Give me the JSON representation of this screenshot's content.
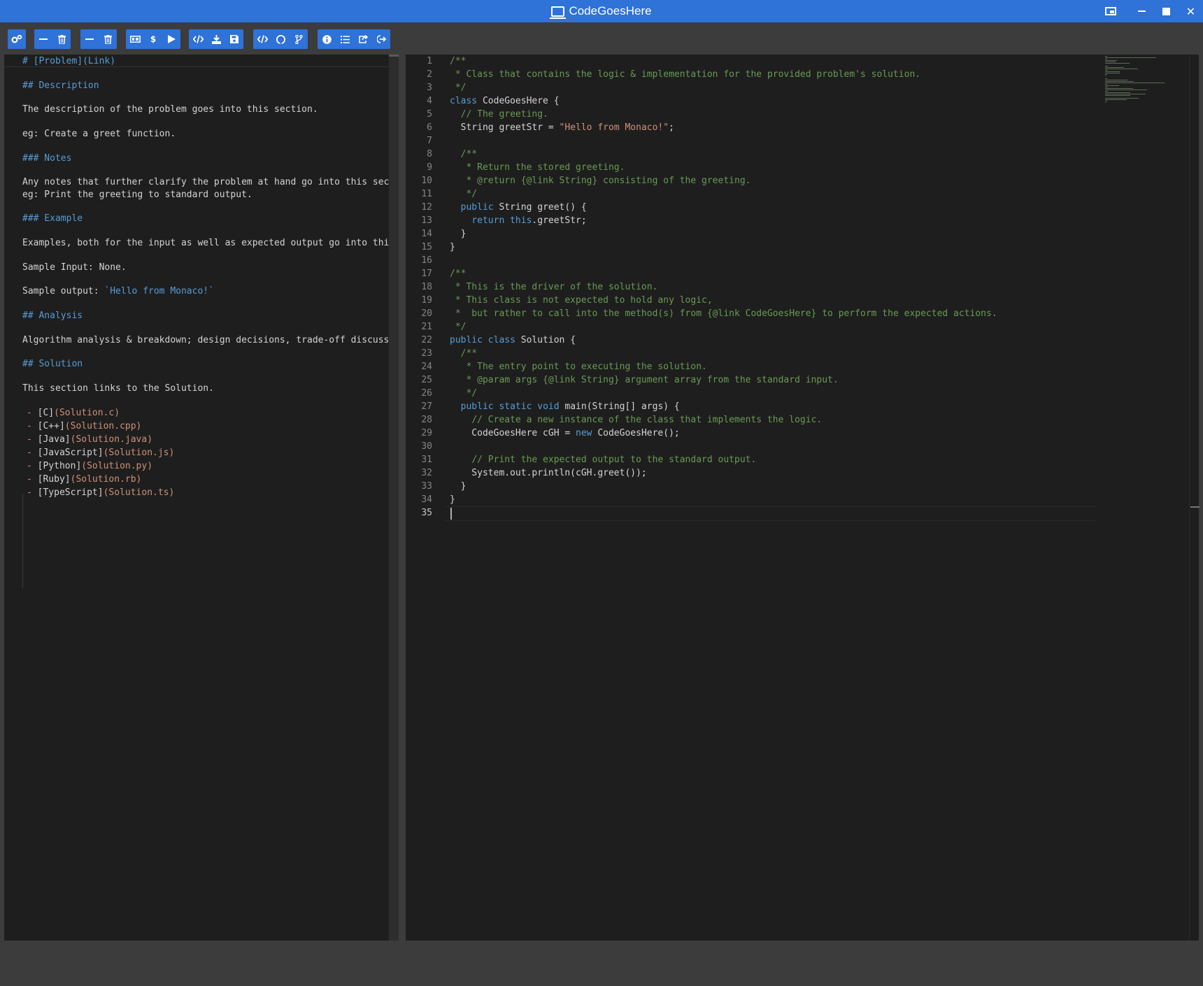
{
  "window": {
    "title": "CodeGoesHere",
    "controls": [
      "picture-in-picture",
      "minimize",
      "maximize",
      "close"
    ]
  },
  "toolbar": {
    "groups": [
      {
        "name": "settings",
        "buttons": [
          "settings-icon"
        ]
      },
      {
        "name": "left-pane",
        "buttons": [
          "collapse-icon",
          "trash-icon"
        ]
      },
      {
        "name": "right-pane",
        "buttons": [
          "collapse-icon",
          "trash-icon"
        ]
      },
      {
        "name": "run",
        "buttons": [
          "input-icon",
          "terminal-icon",
          "play-icon"
        ]
      },
      {
        "name": "code",
        "buttons": [
          "code-icon",
          "download-icon",
          "save-icon"
        ]
      },
      {
        "name": "source",
        "buttons": [
          "code-icon",
          "github-icon",
          "branch-icon"
        ]
      },
      {
        "name": "misc",
        "buttons": [
          "info-icon",
          "list-icon",
          "share-icon",
          "exit-icon"
        ]
      }
    ],
    "dollar_label": "$",
    "input_label": "⌨"
  },
  "markdown": {
    "title_line": "# [Problem](Link)",
    "h_description": "## Description",
    "description": "The description of the problem goes into this section.",
    "description_eg": "eg: Create a greet function.",
    "h_notes": "### Notes",
    "notes": "Any notes that further clarify the problem at hand go into this sectio",
    "notes_eg": "eg: Print the greeting to standard output.",
    "h_example": "### Example",
    "example": "Examples, both for the input as well as expected output go into this s",
    "sample_input": "Sample Input: None.",
    "sample_output_label": "Sample output: ",
    "sample_output_code": "`Hello from Monaco!`",
    "h_analysis": "## Analysis",
    "analysis": "Algorithm analysis & breakdown; design decisions, trade-off discussion",
    "h_solution": "## Solution",
    "solution": "This section links to the Solution.",
    "links": [
      {
        "text": "[C]",
        "url": "(Solution.c)"
      },
      {
        "text": "[C++]",
        "url": "(Solution.cpp)"
      },
      {
        "text": "[Java]",
        "url": "(Solution.java)"
      },
      {
        "text": "[JavaScript]",
        "url": "(Solution.js)"
      },
      {
        "text": "[Python]",
        "url": "(Solution.py)"
      },
      {
        "text": "[Ruby]",
        "url": "(Solution.rb)"
      },
      {
        "text": "[TypeScript]",
        "url": "(Solution.ts)"
      }
    ],
    "bullet": "- "
  },
  "editor": {
    "language": "java",
    "active_line": 35,
    "lines": [
      [
        [
          "cm",
          "/**"
        ]
      ],
      [
        [
          "cm",
          " * Class that contains the logic & implementation for the provided problem's solution."
        ]
      ],
      [
        [
          "cm",
          " */"
        ]
      ],
      [
        [
          "kw",
          "class"
        ],
        [
          "tx",
          " CodeGoesHere {"
        ]
      ],
      [
        [
          "tx",
          "  "
        ],
        [
          "cm",
          "// The greeting."
        ]
      ],
      [
        [
          "tx",
          "  String greetStr = "
        ],
        [
          "str",
          "\"Hello from Monaco!\""
        ],
        [
          "tx",
          ";"
        ]
      ],
      [
        [
          "tx",
          ""
        ]
      ],
      [
        [
          "tx",
          "  "
        ],
        [
          "cm",
          "/**"
        ]
      ],
      [
        [
          "tx",
          "  "
        ],
        [
          "cm",
          " * Return the stored greeting."
        ]
      ],
      [
        [
          "tx",
          "  "
        ],
        [
          "cm",
          " * @return {@link String} consisting of the greeting."
        ]
      ],
      [
        [
          "tx",
          "  "
        ],
        [
          "cm",
          " */"
        ]
      ],
      [
        [
          "tx",
          "  "
        ],
        [
          "kw",
          "public"
        ],
        [
          "tx",
          " String greet() {"
        ]
      ],
      [
        [
          "tx",
          "    "
        ],
        [
          "kw",
          "return"
        ],
        [
          "tx",
          " "
        ],
        [
          "kw",
          "this"
        ],
        [
          "tx",
          ".greetStr;"
        ]
      ],
      [
        [
          "tx",
          "  }"
        ]
      ],
      [
        [
          "tx",
          "}"
        ]
      ],
      [
        [
          "tx",
          ""
        ]
      ],
      [
        [
          "cm",
          "/**"
        ]
      ],
      [
        [
          "cm",
          " * This is the driver of the solution."
        ]
      ],
      [
        [
          "cm",
          " * This class is not expected to hold any logic,"
        ]
      ],
      [
        [
          "cm",
          " *  but rather to call into the method(s) from {@link CodeGoesHere} to perform the expected actions."
        ]
      ],
      [
        [
          "cm",
          " */"
        ]
      ],
      [
        [
          "kw",
          "public"
        ],
        [
          "tx",
          " "
        ],
        [
          "kw",
          "class"
        ],
        [
          "tx",
          " Solution {"
        ]
      ],
      [
        [
          "tx",
          "  "
        ],
        [
          "cm",
          "/**"
        ]
      ],
      [
        [
          "tx",
          "  "
        ],
        [
          "cm",
          " * The entry point to executing the solution."
        ]
      ],
      [
        [
          "tx",
          "  "
        ],
        [
          "cm",
          " * @param args {@link String} argument array from the standard input."
        ]
      ],
      [
        [
          "tx",
          "  "
        ],
        [
          "cm",
          " */"
        ]
      ],
      [
        [
          "tx",
          "  "
        ],
        [
          "kw",
          "public"
        ],
        [
          "tx",
          " "
        ],
        [
          "kw",
          "static"
        ],
        [
          "tx",
          " "
        ],
        [
          "kw",
          "void"
        ],
        [
          "tx",
          " main(String[] args) {"
        ]
      ],
      [
        [
          "tx",
          "    "
        ],
        [
          "cm",
          "// Create a new instance of the class that implements the logic."
        ]
      ],
      [
        [
          "tx",
          "    CodeGoesHere cGH = "
        ],
        [
          "kw",
          "new"
        ],
        [
          "tx",
          " CodeGoesHere();"
        ]
      ],
      [
        [
          "tx",
          ""
        ]
      ],
      [
        [
          "tx",
          "    "
        ],
        [
          "cm",
          "// Print the expected output to the standard output."
        ]
      ],
      [
        [
          "tx",
          "    System.out.println(cGH.greet());"
        ]
      ],
      [
        [
          "tx",
          "  }"
        ]
      ],
      [
        [
          "tx",
          "}"
        ]
      ],
      [
        [
          "tx",
          ""
        ]
      ]
    ]
  },
  "colors": {
    "titlebar": "#2f72d8",
    "toolbar_button": "#2f72d8",
    "editor_bg": "#1e1e1e",
    "comment": "#6a9955",
    "keyword": "#569cd6",
    "string": "#ce9178"
  }
}
